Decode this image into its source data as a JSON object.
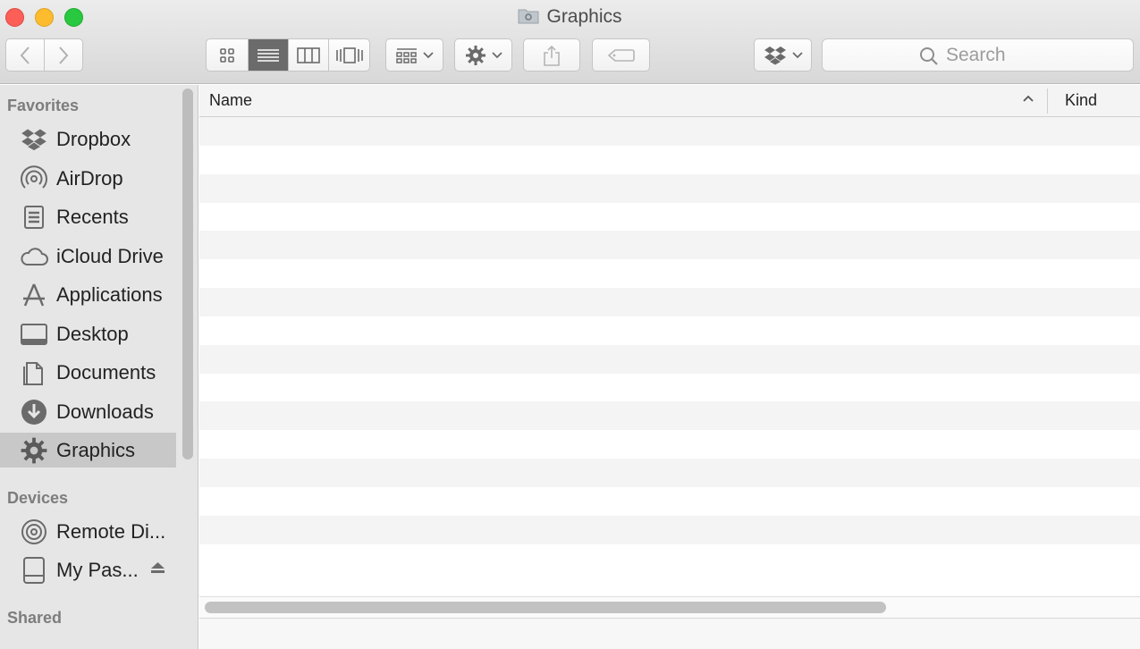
{
  "window": {
    "title": "Graphics"
  },
  "toolbar": {
    "back_icon": "chevron-left-icon",
    "forward_icon": "chevron-right-icon",
    "view_modes": [
      "icon-view-icon",
      "list-view-icon",
      "column-view-icon",
      "cover-flow-icon"
    ],
    "active_view": "list",
    "group_icon": "group-by-icon",
    "action_icon": "gear-icon",
    "share_icon": "share-icon",
    "tag_icon": "tag-icon",
    "dropbox_icon": "dropbox-icon"
  },
  "search": {
    "placeholder": "Search"
  },
  "sidebar": {
    "favorites_label": "Favorites",
    "favorites": [
      {
        "label": "Dropbox",
        "icon": "dropbox-icon"
      },
      {
        "label": "AirDrop",
        "icon": "airdrop-icon"
      },
      {
        "label": "Recents",
        "icon": "recents-icon"
      },
      {
        "label": "iCloud Drive",
        "icon": "cloud-icon"
      },
      {
        "label": "Applications",
        "icon": "applications-icon"
      },
      {
        "label": "Desktop",
        "icon": "desktop-icon"
      },
      {
        "label": "Documents",
        "icon": "documents-icon"
      },
      {
        "label": "Downloads",
        "icon": "downloads-icon"
      },
      {
        "label": "Graphics",
        "icon": "gear-icon",
        "selected": true
      }
    ],
    "devices_label": "Devices",
    "devices": [
      {
        "label": "Remote Di...",
        "icon": "disc-icon"
      },
      {
        "label": "My Pas...",
        "icon": "drive-icon",
        "ejectable": true
      }
    ],
    "shared_label": "Shared"
  },
  "list": {
    "columns": [
      "Name",
      "Kind"
    ],
    "sort_column": "Name",
    "sort_direction": "ascending",
    "rows": []
  },
  "colors": {
    "close": "#fc5f57",
    "minimize": "#fdbc2e",
    "zoom": "#28c840",
    "sidebar_bg": "#e6e6e6",
    "selected_bg": "#c8c8c8",
    "active_segment": "#6b6b6b"
  }
}
